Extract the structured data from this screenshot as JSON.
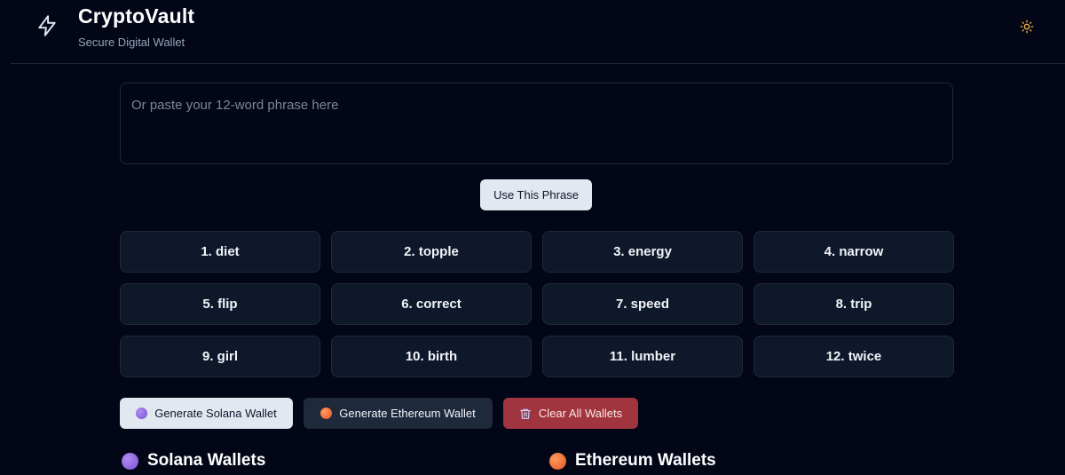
{
  "header": {
    "title": "CryptoVault",
    "subtitle": "Secure Digital Wallet",
    "logo_icon": "lightning-bolt-icon",
    "theme_icon": "sun-icon"
  },
  "phrase_input": {
    "placeholder": "Or paste your 12-word phrase here",
    "value": ""
  },
  "use_phrase_label": "Use This Phrase",
  "mnemonic": [
    "1. diet",
    "2. topple",
    "3. energy",
    "4. narrow",
    "5. flip",
    "6. correct",
    "7. speed",
    "8. trip",
    "9. girl",
    "10. birth",
    "11. lumber",
    "12. twice"
  ],
  "actions": {
    "generate_solana": "Generate Solana Wallet",
    "generate_ethereum": "Generate Ethereum Wallet",
    "clear_all": "Clear All Wallets"
  },
  "sections": {
    "solana_title": "Solana Wallets",
    "ethereum_title": "Ethereum Wallets"
  },
  "colors": {
    "background": "#020617",
    "solana_accent": "#8b5cf6",
    "ethereum_accent": "#f97316",
    "danger": "#a0353f",
    "sun_icon": "#f5b942"
  }
}
